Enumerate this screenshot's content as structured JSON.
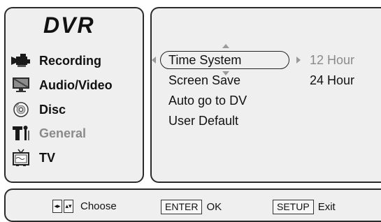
{
  "sidebar": {
    "brand": "DVR",
    "items": [
      {
        "label": "Recording",
        "icon": "camcorder-icon",
        "active": false
      },
      {
        "label": "Audio/Video",
        "icon": "monitor-icon",
        "active": false
      },
      {
        "label": "Disc",
        "icon": "disc-icon",
        "active": false
      },
      {
        "label": "General",
        "icon": "settings-tools-icon",
        "active": true
      },
      {
        "label": "TV",
        "icon": "tv-icon",
        "active": false
      }
    ]
  },
  "settings": {
    "options": [
      "Time System",
      "Screen Save",
      "Auto go to DV",
      "User Default"
    ],
    "selected_option": "Time System",
    "values": [
      "12 Hour",
      "24 Hour"
    ],
    "selected_value": "12 Hour"
  },
  "footer": {
    "choose_label": "Choose",
    "enter_key": "ENTER",
    "enter_label": "OK",
    "setup_key": "SETUP",
    "setup_label": "Exit"
  },
  "colors": {
    "panel_bg": "#efefef",
    "border": "#2b2b2b",
    "dim_text": "#8a8a8a"
  }
}
